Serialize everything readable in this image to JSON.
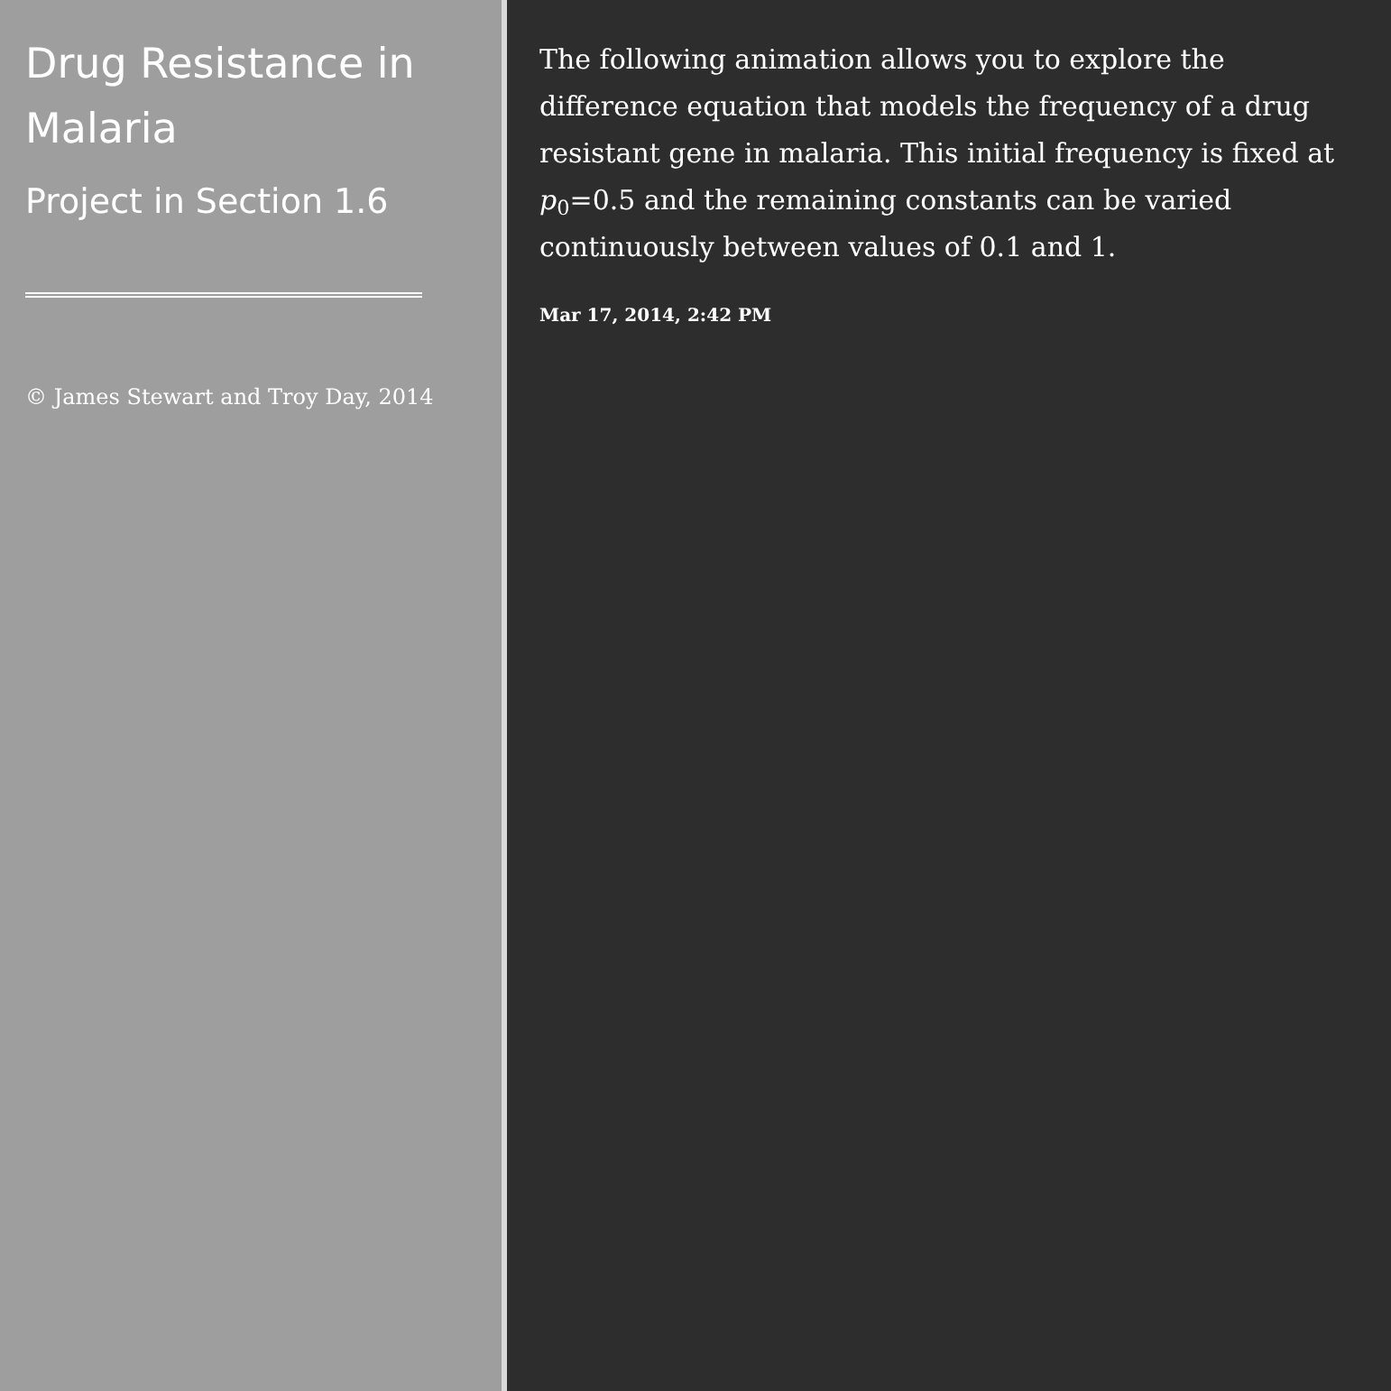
{
  "sidebar": {
    "title": "Drug Resistance in Malaria",
    "subtitle": "Project in Section 1.6",
    "copyright": "© James Stewart and Troy Day, 2014"
  },
  "content": {
    "description": "The following animation allows you to explore the difference equation that models the frequency of a drug resistant gene in malaria. This initial frequency is fixed at *p*$_{0}$=0.5 and the remaining constants can be varied continuously between values of 0.1 and 1.",
    "date": "Mar 17, 2014, 2:42 PM"
  }
}
